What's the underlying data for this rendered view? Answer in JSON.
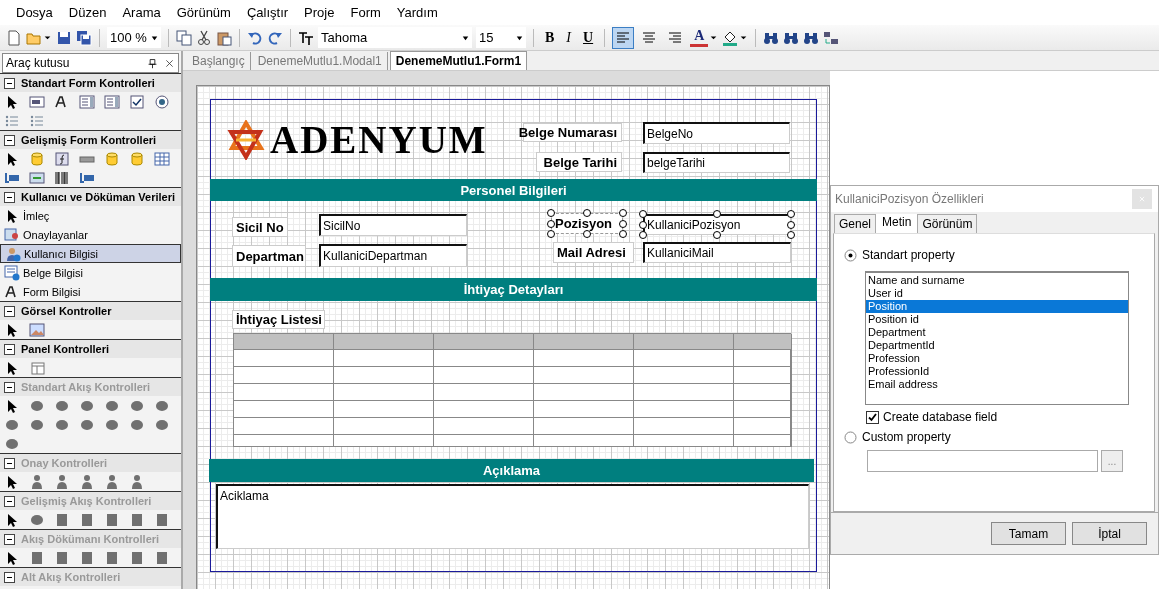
{
  "menu": [
    {
      "label": "Dosya"
    },
    {
      "label": "Düzen"
    },
    {
      "label": "Arama"
    },
    {
      "label": "Görünüm"
    },
    {
      "label": "Çalıştır"
    },
    {
      "label": "Proje"
    },
    {
      "label": "Form"
    },
    {
      "label": "Yardım"
    }
  ],
  "toolbar": {
    "zoom": "100 %",
    "font": "Tahoma",
    "size": "15",
    "format_buttons": [
      {
        "label": "B",
        "kind": "bold"
      },
      {
        "label": "I",
        "kind": "italic"
      },
      {
        "label": "U",
        "kind": "underline"
      },
      {
        "label": "A",
        "kind": "color"
      }
    ],
    "alignment": [
      {
        "selected": true
      },
      {
        "selected": false
      },
      {
        "selected": false
      }
    ]
  },
  "toolbox": {
    "title": "Araç kutusu",
    "sections": [
      {
        "title": "Standart Form Kontrolleri",
        "expanded": true,
        "disabled": false,
        "kind": "icons"
      },
      {
        "title": "Gelişmiş Form Kontrolleri",
        "expanded": true,
        "disabled": false,
        "kind": "icons"
      },
      {
        "title": "Kullanıcı ve Döküman Verileri",
        "expanded": true,
        "disabled": false,
        "kind": "items",
        "items": [
          {
            "label": "İmleç",
            "selected": false
          },
          {
            "label": "Onaylayanlar",
            "selected": false
          },
          {
            "label": "Kullanıcı Bilgisi",
            "selected": true
          },
          {
            "label": "Belge Bilgisi",
            "selected": false
          },
          {
            "label": "Form Bilgisi",
            "selected": false
          }
        ]
      },
      {
        "title": "Görsel Kontroller",
        "expanded": true,
        "disabled": false,
        "kind": "icons"
      },
      {
        "title": "Panel Kontrolleri",
        "expanded": true,
        "disabled": false,
        "kind": "icons"
      },
      {
        "title": "Standart Akış Kontrolleri",
        "expanded": true,
        "disabled": true,
        "kind": "icons"
      },
      {
        "title": "Onay Kontrolleri",
        "expanded": true,
        "disabled": true,
        "kind": "icons"
      },
      {
        "title": "Gelişmiş Akış Kontrolleri",
        "expanded": true,
        "disabled": true,
        "kind": "icons"
      },
      {
        "title": "Akış Dökümanı Kontrolleri",
        "expanded": true,
        "disabled": true,
        "kind": "icons"
      },
      {
        "title": "Alt Akış Kontrolleri",
        "expanded": true,
        "disabled": true,
        "kind": "icons"
      }
    ]
  },
  "tabs": [
    {
      "label": "Başlangıç",
      "selected": false
    },
    {
      "label": "DenemeMutlu1.Modal1",
      "selected": false
    },
    {
      "label": "DenemeMutlu1.Form1",
      "selected": true
    }
  ],
  "form": {
    "logo": "ADENYUM",
    "header_fields": [
      {
        "label": "Belge Numarası",
        "value": "BelgeNo",
        "selected": false
      },
      {
        "label": "Belge Tarihi",
        "value": "belgeTarihi",
        "selected": false
      }
    ],
    "sections": [
      {
        "title": "Personel Bilgileri"
      },
      {
        "title": "İhtiyaç Detayları"
      },
      {
        "title": "Açıklama"
      }
    ],
    "personnel_fields": [
      {
        "label": "Sicil No",
        "value": "SicilNo",
        "selected": false
      },
      {
        "label": "Pozisyon",
        "value": "KullaniciPozisyon",
        "selected": true
      },
      {
        "label": "Departman",
        "value": "KullaniciDepartman",
        "selected": false
      },
      {
        "label": "Mail Adresi",
        "value": "KullaniciMail",
        "selected": false
      }
    ],
    "list_label": "İhtiyaç Listesi",
    "description": "Aciklama"
  },
  "dialog": {
    "title": "KullaniciPozisyon Özellikleri",
    "tabs": [
      {
        "label": "Genel",
        "selected": false
      },
      {
        "label": "Metin",
        "selected": true
      },
      {
        "label": "Görünüm",
        "selected": false
      }
    ],
    "options": [
      {
        "label": "Standart property",
        "selected": true
      },
      {
        "label": "Custom property",
        "selected": false
      }
    ],
    "properties": [
      {
        "label": "Name and surname",
        "selected": false
      },
      {
        "label": "User id",
        "selected": false
      },
      {
        "label": "Position",
        "selected": true
      },
      {
        "label": "Position id",
        "selected": false
      },
      {
        "label": "Department",
        "selected": false
      },
      {
        "label": "DepartmentId",
        "selected": false
      },
      {
        "label": "Profession",
        "selected": false
      },
      {
        "label": "ProfessionId",
        "selected": false
      },
      {
        "label": "Email address",
        "selected": false
      }
    ],
    "create_field": {
      "label": "Create database field",
      "checked": true
    },
    "browse_button": "...",
    "buttons": [
      "Tamam",
      "İptal"
    ]
  }
}
